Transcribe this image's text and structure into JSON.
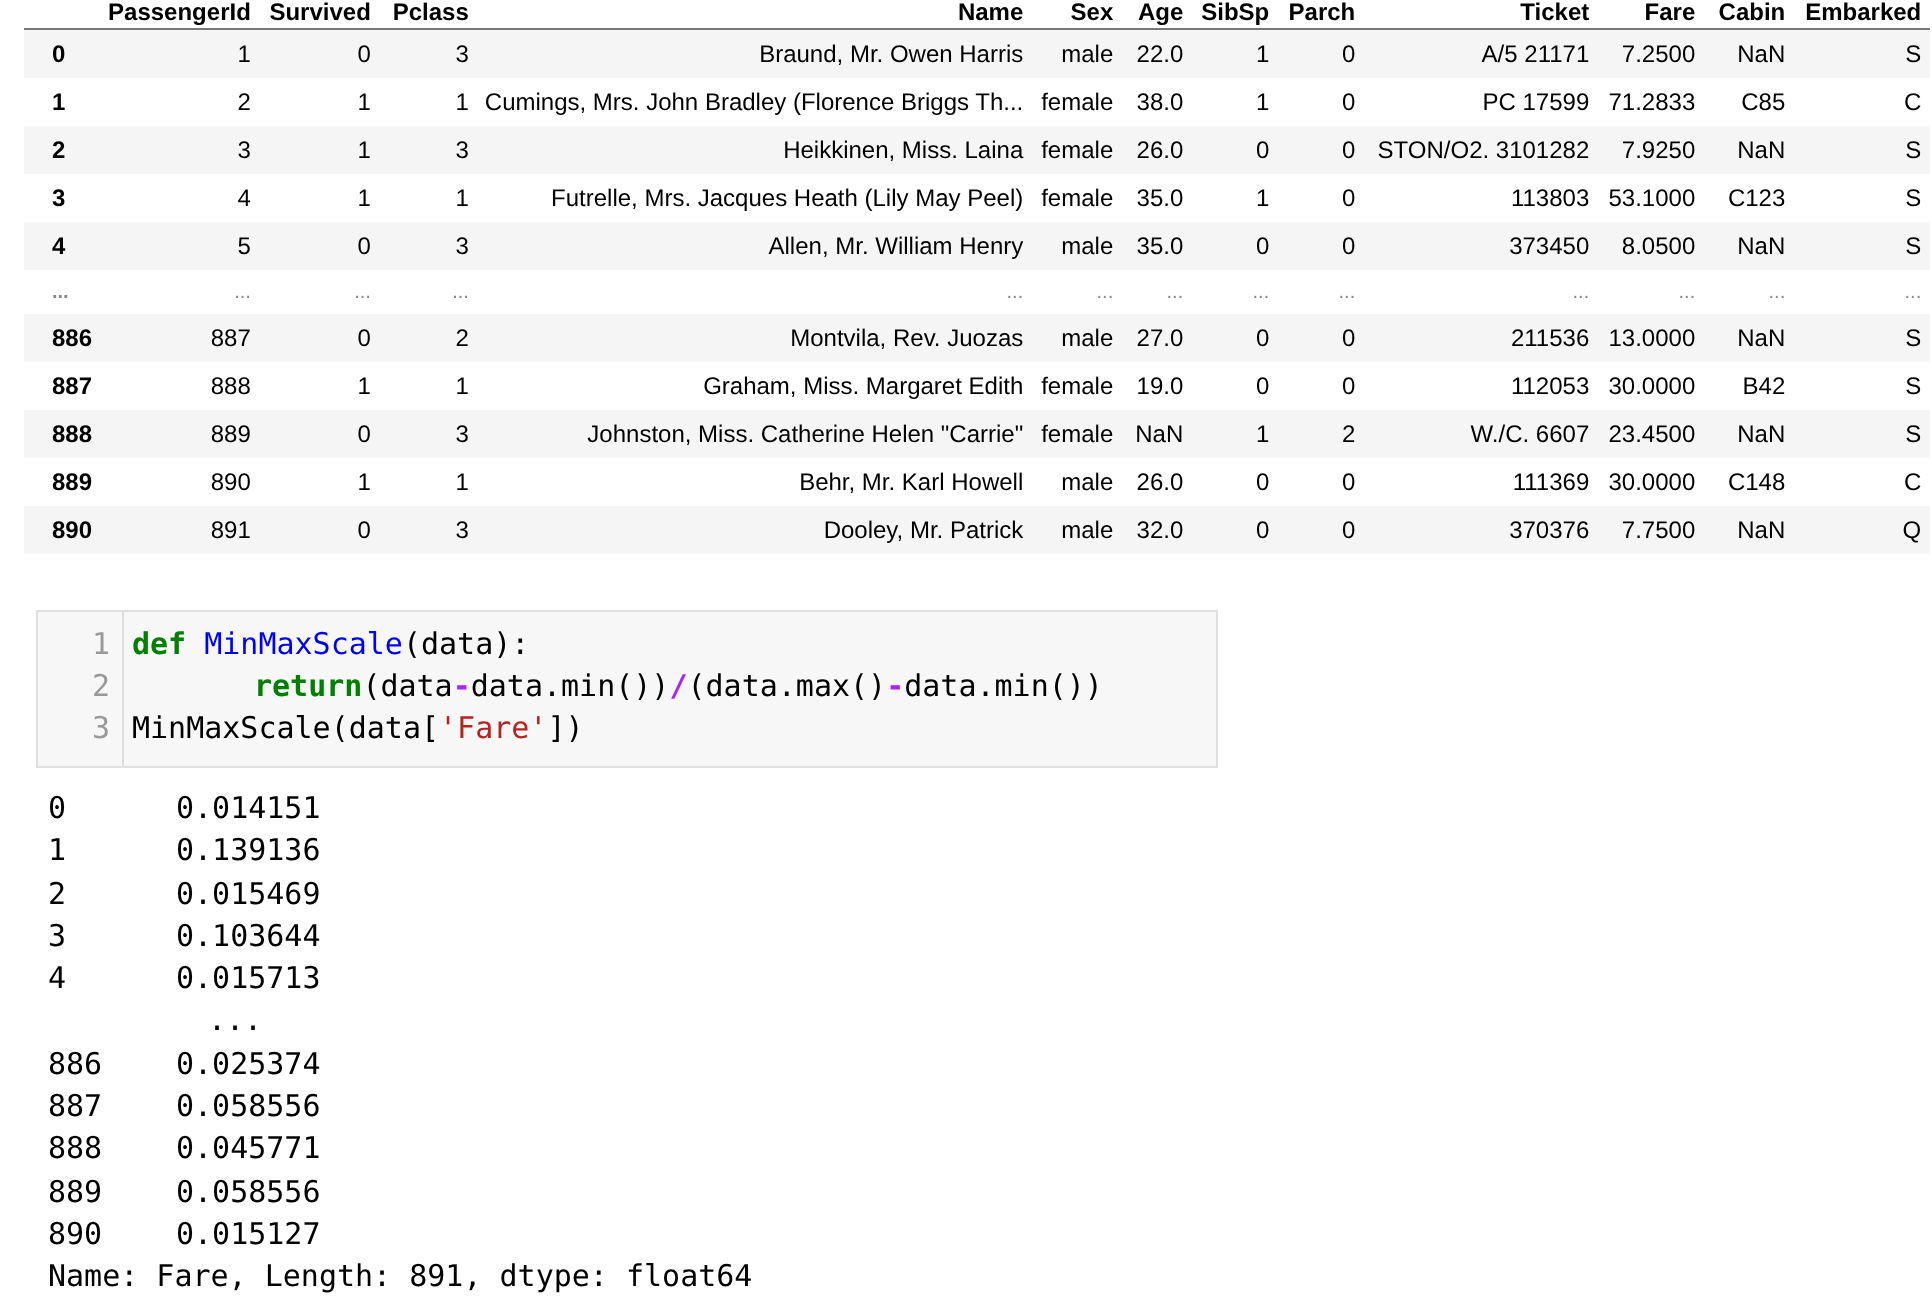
{
  "dataframe": {
    "columns": [
      "",
      "PassengerId",
      "Survived",
      "Pclass",
      "Name",
      "Sex",
      "Age",
      "SibSp",
      "Parch",
      "Ticket",
      "Fare",
      "Cabin",
      "Embarked"
    ],
    "rows": [
      {
        "kind": "data",
        "cells": [
          "0",
          "1",
          "0",
          "3",
          "Braund, Mr. Owen Harris",
          "male",
          "22.0",
          "1",
          "0",
          "A/5 21171",
          "7.2500",
          "NaN",
          "S"
        ]
      },
      {
        "kind": "data",
        "cells": [
          "1",
          "2",
          "1",
          "1",
          "Cumings, Mrs. John Bradley (Florence Briggs Th...",
          "female",
          "38.0",
          "1",
          "0",
          "PC 17599",
          "71.2833",
          "C85",
          "C"
        ]
      },
      {
        "kind": "data",
        "cells": [
          "2",
          "3",
          "1",
          "3",
          "Heikkinen, Miss. Laina",
          "female",
          "26.0",
          "0",
          "0",
          "STON/O2. 3101282",
          "7.9250",
          "NaN",
          "S"
        ]
      },
      {
        "kind": "data",
        "cells": [
          "3",
          "4",
          "1",
          "1",
          "Futrelle, Mrs. Jacques Heath (Lily May Peel)",
          "female",
          "35.0",
          "1",
          "0",
          "113803",
          "53.1000",
          "C123",
          "S"
        ]
      },
      {
        "kind": "data",
        "cells": [
          "4",
          "5",
          "0",
          "3",
          "Allen, Mr. William Henry",
          "male",
          "35.0",
          "0",
          "0",
          "373450",
          "8.0500",
          "NaN",
          "S"
        ]
      },
      {
        "kind": "ellipsis",
        "cells": [
          "...",
          "...",
          "...",
          "...",
          "...",
          "...",
          "...",
          "...",
          "...",
          "...",
          "...",
          "...",
          "..."
        ]
      },
      {
        "kind": "data",
        "cells": [
          "886",
          "887",
          "0",
          "2",
          "Montvila, Rev. Juozas",
          "male",
          "27.0",
          "0",
          "0",
          "211536",
          "13.0000",
          "NaN",
          "S"
        ]
      },
      {
        "kind": "data",
        "cells": [
          "887",
          "888",
          "1",
          "1",
          "Graham, Miss. Margaret Edith",
          "female",
          "19.0",
          "0",
          "0",
          "112053",
          "30.0000",
          "B42",
          "S"
        ]
      },
      {
        "kind": "data",
        "cells": [
          "888",
          "889",
          "0",
          "3",
          "Johnston, Miss. Catherine Helen \"Carrie\"",
          "female",
          "NaN",
          "1",
          "2",
          "W./C. 6607",
          "23.4500",
          "NaN",
          "S"
        ]
      },
      {
        "kind": "data",
        "cells": [
          "889",
          "890",
          "1",
          "1",
          "Behr, Mr. Karl Howell",
          "male",
          "26.0",
          "0",
          "0",
          "111369",
          "30.0000",
          "C148",
          "C"
        ]
      },
      {
        "kind": "data",
        "cells": [
          "890",
          "891",
          "0",
          "3",
          "Dooley, Mr. Patrick",
          "male",
          "32.0",
          "0",
          "0",
          "370376",
          "7.7500",
          "NaN",
          "Q"
        ]
      }
    ]
  },
  "code_cell": {
    "lines": [
      {
        "number": "1",
        "indented": false,
        "tokens": [
          {
            "kind": "keyword",
            "text": "def"
          },
          {
            "kind": "defname",
            "text": "MinMaxScale"
          },
          {
            "kind": "plain",
            "text": "(data):"
          }
        ]
      },
      {
        "number": "2",
        "indented": true,
        "tokens": [
          {
            "kind": "keyword",
            "text": "return"
          },
          {
            "kind": "plain",
            "text": "(data"
          },
          {
            "kind": "operator",
            "text": "-"
          },
          {
            "kind": "plain",
            "text": "data.min())"
          },
          {
            "kind": "operator",
            "text": "/"
          },
          {
            "kind": "plain",
            "text": "(data.max()"
          },
          {
            "kind": "operator",
            "text": "-"
          },
          {
            "kind": "plain",
            "text": "data.min())"
          }
        ]
      },
      {
        "number": "3",
        "indented": false,
        "tokens": [
          {
            "kind": "plain",
            "text": "MinMaxScale(data["
          },
          {
            "kind": "string",
            "text": "'Fare'"
          },
          {
            "kind": "plain",
            "text": "])"
          }
        ]
      }
    ]
  },
  "output": {
    "rows": [
      {
        "kind": "value",
        "index": "0",
        "value": "0.014151"
      },
      {
        "kind": "value",
        "index": "1",
        "value": "0.139136"
      },
      {
        "kind": "value",
        "index": "2",
        "value": "0.015469"
      },
      {
        "kind": "value",
        "index": "3",
        "value": "0.103644"
      },
      {
        "kind": "value",
        "index": "4",
        "value": "0.015713"
      },
      {
        "kind": "ellipsis",
        "index": "",
        "value": "..."
      },
      {
        "kind": "value",
        "index": "886",
        "value": "0.025374"
      },
      {
        "kind": "value",
        "index": "887",
        "value": "0.058556"
      },
      {
        "kind": "value",
        "index": "888",
        "value": "0.045771"
      },
      {
        "kind": "value",
        "index": "889",
        "value": "0.058556"
      },
      {
        "kind": "value",
        "index": "890",
        "value": "0.015127"
      }
    ],
    "footer": "Name: Fare, Length: 891, dtype: float64"
  }
}
